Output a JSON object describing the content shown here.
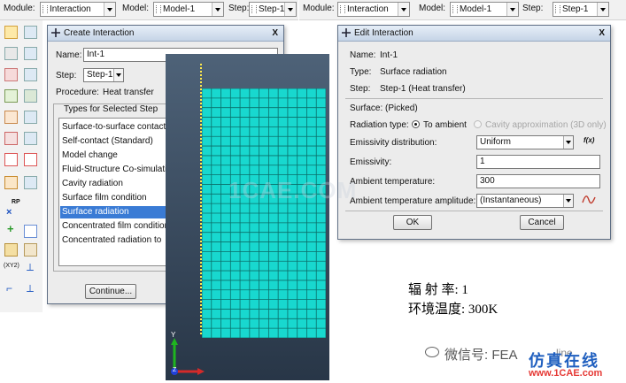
{
  "left_bar": {
    "module_label": "Module:",
    "module_value": "Interaction",
    "model_label": "Model:",
    "model_value": "Model-1",
    "step_label": "Step:",
    "step_value": "Step-1"
  },
  "right_bar": {
    "module_label": "Module:",
    "module_value": "Interaction",
    "model_label": "Model:",
    "model_value": "Model-1",
    "step_label": "Step:",
    "step_value": "Step-1"
  },
  "create_dialog": {
    "title": "Create Interaction",
    "close": "X",
    "name_label": "Name:",
    "name_value": "Int-1",
    "step_label": "Step:",
    "step_value": "Step-1",
    "procedure_label": "Procedure:",
    "procedure_value": "Heat transfer",
    "types_label": "Types for Selected Step",
    "types": [
      "Surface-to-surface contact",
      "Self-contact (Standard)",
      "Model change",
      "Fluid-Structure Co-simulation",
      "Cavity radiation",
      "Surface film condition",
      "Surface radiation",
      "Concentrated film condition",
      "Concentrated radiation to"
    ],
    "selected_index": 6,
    "continue_label": "Continue..."
  },
  "edit_dialog": {
    "title": "Edit Interaction",
    "close": "X",
    "name_label": "Name:",
    "name_value": "Int-1",
    "type_label": "Type:",
    "type_value": "Surface radiation",
    "step_label": "Step:",
    "step_value": "Step-1 (Heat transfer)",
    "surface_label": "Surface:",
    "surface_value": "(Picked)",
    "radiation_type_label": "Radiation type:",
    "radiation_option_1": "To ambient",
    "radiation_option_2": "Cavity approximation (3D only)",
    "emissivity_dist_label": "Emissivity distribution:",
    "emissivity_dist_value": "Uniform",
    "fx_label": "f(x)",
    "emissivity_label": "Emissivity:",
    "emissivity_value": "1",
    "ambient_temp_label": "Ambient temperature:",
    "ambient_temp_value": "300",
    "ambient_amp_label": "Ambient temperature amplitude:",
    "ambient_amp_value": "(Instantaneous)",
    "ok_label": "OK",
    "cancel_label": "Cancel"
  },
  "toolbox": {
    "rp_label": "RP",
    "xyz_label": "(XY2)"
  },
  "viewport": {
    "axis_y": "Y",
    "axis_z": "Z"
  },
  "annotation": {
    "line1": "辐 射 率: 1",
    "line2": "环境温度: 300K"
  },
  "watermark": {
    "center": "1CAE.COM",
    "wechat": "微信号: FEA",
    "wechat_tail": "line",
    "brand_cn": "仿真在线",
    "brand_url": "www.1CAE.com"
  },
  "colors": {
    "mesh": "#18d8cf",
    "selection": "#3a7bd5",
    "watermark_blue": "#1f5fbf",
    "watermark_red": "#e53935"
  }
}
